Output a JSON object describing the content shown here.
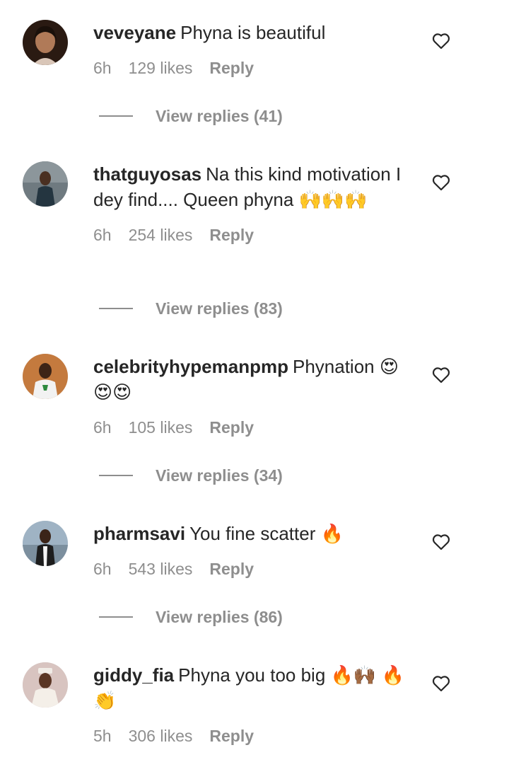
{
  "comments": [
    {
      "username": "veveyane",
      "text": "Phyna is beautiful",
      "time": "6h",
      "likes": "129 likes",
      "reply_label": "Reply",
      "view_replies": "View replies (41)",
      "avatar_icon": "avatar-veveyane"
    },
    {
      "username": "thatguyosas",
      "text": "Na this kind motivation I dey find.... Queen phyna 🙌🙌🙌",
      "time": "6h",
      "likes": "254 likes",
      "reply_label": "Reply",
      "view_replies": "View replies (83)",
      "avatar_icon": "avatar-thatguyosas"
    },
    {
      "username": "celebrityhypemanpmp",
      "text": "Phynation 😍😍😍",
      "time": "6h",
      "likes": "105 likes",
      "reply_label": "Reply",
      "view_replies": "View replies (34)",
      "avatar_icon": "avatar-celebrityhypemanpmp"
    },
    {
      "username": "pharmsavi",
      "text": "You fine scatter 🔥",
      "time": "6h",
      "likes": "543 likes",
      "reply_label": "Reply",
      "view_replies": "View replies (86)",
      "avatar_icon": "avatar-pharmsavi"
    },
    {
      "username": "giddy_fia",
      "text": "Phyna you too big 🔥🙌🏾 🔥👏",
      "time": "5h",
      "likes": "306 likes",
      "reply_label": "Reply",
      "avatar_icon": "avatar-giddy-fia"
    }
  ],
  "colors": {
    "text": "#262626",
    "muted": "#8e8e8e",
    "background": "#ffffff"
  },
  "icons": {
    "like": "heart-outline-icon"
  }
}
